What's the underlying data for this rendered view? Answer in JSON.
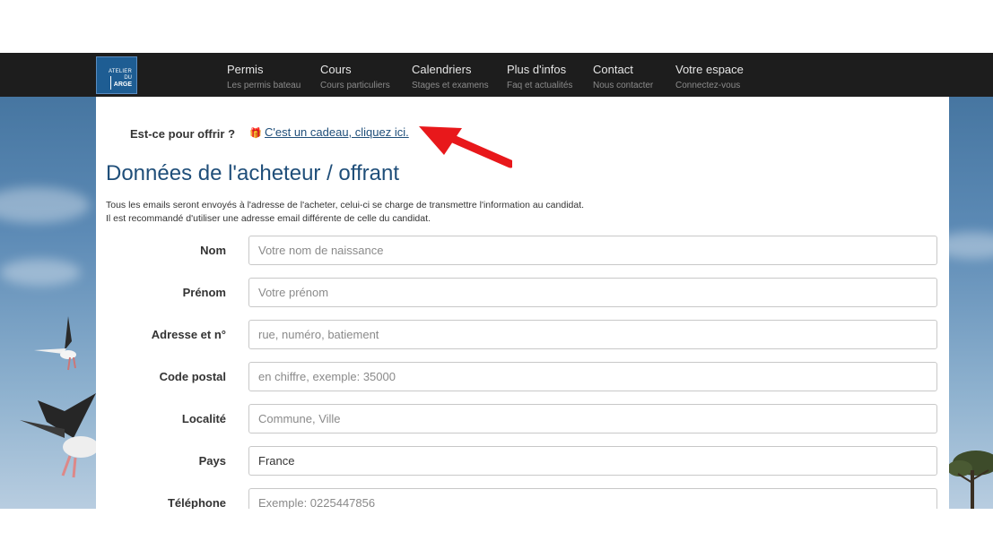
{
  "brand": {
    "logo_line1": "ATELIER",
    "logo_line2": "DU",
    "logo_line3": "ARGE"
  },
  "nav": [
    {
      "title": "Permis",
      "subtitle": "Les permis bateau"
    },
    {
      "title": "Cours",
      "subtitle": "Cours particuliers"
    },
    {
      "title": "Calendriers",
      "subtitle": "Stages et examens"
    },
    {
      "title": "Plus d'infos",
      "subtitle": "Faq et actualités"
    },
    {
      "title": "Contact",
      "subtitle": "Nous contacter"
    },
    {
      "title": "Votre espace",
      "subtitle": "Connectez-vous"
    }
  ],
  "gift": {
    "question": "Est-ce pour offrir ?",
    "icon": "gift-icon",
    "link": "C'est un cadeau, cliquez ici."
  },
  "section": {
    "title": "Données de l'acheteur / offrant",
    "info_line1": "Tous les emails seront envoyés à l'adresse de l'acheter, celui-ci se charge de transmettre l'information au candidat.",
    "info_line2": "Il est recommandé d'utiliser une adresse email différente de celle du candidat."
  },
  "form": {
    "fields": [
      {
        "label": "Nom",
        "placeholder": "Votre nom de naissance",
        "value": ""
      },
      {
        "label": "Prénom",
        "placeholder": "Votre prénom",
        "value": ""
      },
      {
        "label": "Adresse et n°",
        "placeholder": "rue, numéro, batiement",
        "value": ""
      },
      {
        "label": "Code postal",
        "placeholder": "en chiffre, exemple: 35000",
        "value": ""
      },
      {
        "label": "Localité",
        "placeholder": "Commune, Ville",
        "value": ""
      },
      {
        "label": "Pays",
        "placeholder": "",
        "value": "France"
      },
      {
        "label": "Téléphone",
        "placeholder": "Exemple: 0225447856",
        "value": ""
      }
    ]
  },
  "colors": {
    "nav_bg": "#1d1d1d",
    "accent": "#1f4e79",
    "arrow": "#e8181b",
    "logo_bg": "#1e5d93"
  }
}
